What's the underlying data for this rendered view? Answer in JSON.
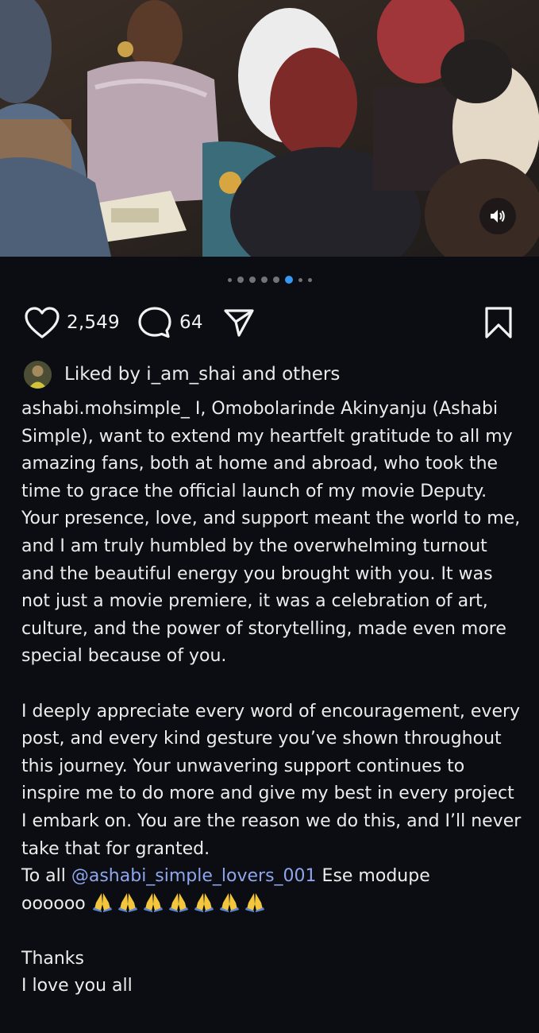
{
  "media": {
    "carousel": {
      "count": 8,
      "active_index": 5
    }
  },
  "actions": {
    "likes_count": "2,549",
    "comments_count": "64"
  },
  "liked_by": {
    "text": "Liked by i_am_shai and others"
  },
  "caption": {
    "username": "ashabi.mohsimple_",
    "paragraph1": " I, Omobolarinde Akinyanju (Ashabi Simple), want to extend my heartfelt gratitude to all my amazing fans, both at home and abroad, who took the time to grace the official launch of my movie Deputy. Your presence, love, and support meant the world to me, and I am truly humbled by the overwhelming turnout and the beautiful energy you brought with you. It was not just a movie premiere, it was a celebration of art, culture, and the power of storytelling, made even more special because of you.",
    "paragraph2": "I deeply appreciate every word of encouragement, every post, and every kind gesture you’ve shown throughout this journey. Your unwavering support continues to inspire me to do more and give my best in every project I embark on. You are the reason we do this, and I’ll never take that for granted.",
    "line_to_all_prefix": "To all ",
    "mention": "@ashabi_simple_lovers_001",
    "line_to_all_suffix": " Ese modupe",
    "line_oooooo": "oooooo",
    "emoji_icon": "folded-hands-icon",
    "emoji_count": 7,
    "thanks": "Thanks",
    "love": "I love you all"
  },
  "colors": {
    "background": "#0b0d12",
    "accent_blue": "#3897f0",
    "mention": "#8ea6ee"
  }
}
